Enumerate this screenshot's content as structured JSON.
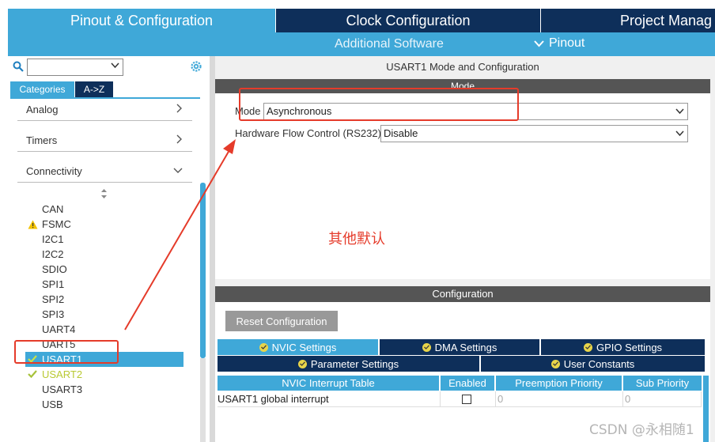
{
  "top_tabs": {
    "pinout": "Pinout & Configuration",
    "clock": "Clock Configuration",
    "project": "Project Manag"
  },
  "subbar": {
    "additional_software": "Additional Software",
    "pinout": "Pinout"
  },
  "left": {
    "search_value": "",
    "tab_categories": "Categories",
    "tab_az": "A->Z",
    "categories": [
      {
        "label": "Analog"
      },
      {
        "label": "Timers"
      },
      {
        "label": "Connectivity"
      }
    ],
    "peripherals": [
      "CAN",
      "FSMC",
      "I2C1",
      "I2C2",
      "SDIO",
      "SPI1",
      "SPI2",
      "SPI3",
      "UART4",
      "UART5",
      "USART1",
      "USART2",
      "USART3",
      "USB"
    ]
  },
  "right": {
    "mode_title": "USART1 Mode and Configuration",
    "mode_bar": "Mode",
    "mode_label": "Mode",
    "mode_value": "Asynchronous",
    "flow_label": "Hardware Flow Control (RS232)",
    "flow_value": "Disable",
    "note": "其他默认",
    "config_bar": "Configuration",
    "reset_button": "Reset Configuration",
    "tabs": {
      "nvic": "NVIC Settings",
      "dma": "DMA Settings",
      "gpio": "GPIO Settings",
      "param": "Parameter Settings",
      "user": "User Constants"
    },
    "table": {
      "headers": [
        "NVIC Interrupt Table",
        "Enabled",
        "Preemption Priority",
        "Sub Priority"
      ],
      "row": {
        "name": "USART1 global interrupt",
        "preemption": "0",
        "sub": "0"
      }
    }
  },
  "watermark": "CSDN @永相随1",
  "colors": {
    "accent": "#3fa8d8",
    "navy": "#0e2f5a",
    "annotation_red": "#e53b2a",
    "warning": "#f2c200",
    "ok_green": "#a7c23a"
  }
}
